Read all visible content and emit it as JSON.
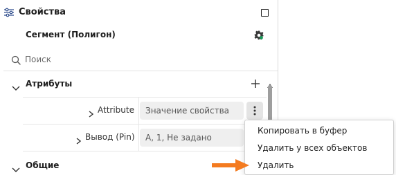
{
  "panel": {
    "title": "Свойства",
    "entity_title": "Сегмент (Полигон)"
  },
  "search": {
    "placeholder": "Поиск",
    "value": ""
  },
  "sections": {
    "attributes": "Атрибуты",
    "general": "Общие"
  },
  "rows": [
    {
      "label": "Attribute",
      "value": "Значение свойства"
    },
    {
      "label": "Вывод (Pin)",
      "value": "А, 1, Не задано"
    }
  ],
  "context_menu": {
    "items": [
      "Копировать в буфер",
      "Удалить у всех объектов",
      "Удалить"
    ]
  },
  "colors": {
    "annotation_arrow": "#f47b20",
    "gear_accent": "#1a9b5a"
  },
  "icons": [
    "properties-icon",
    "maximize-icon",
    "settings-gear-icon",
    "search-icon",
    "chevron-down-icon",
    "chevron-right-icon",
    "plus-icon",
    "more-vertical-icon",
    "scroll-up-icon",
    "arrow-right-icon"
  ]
}
